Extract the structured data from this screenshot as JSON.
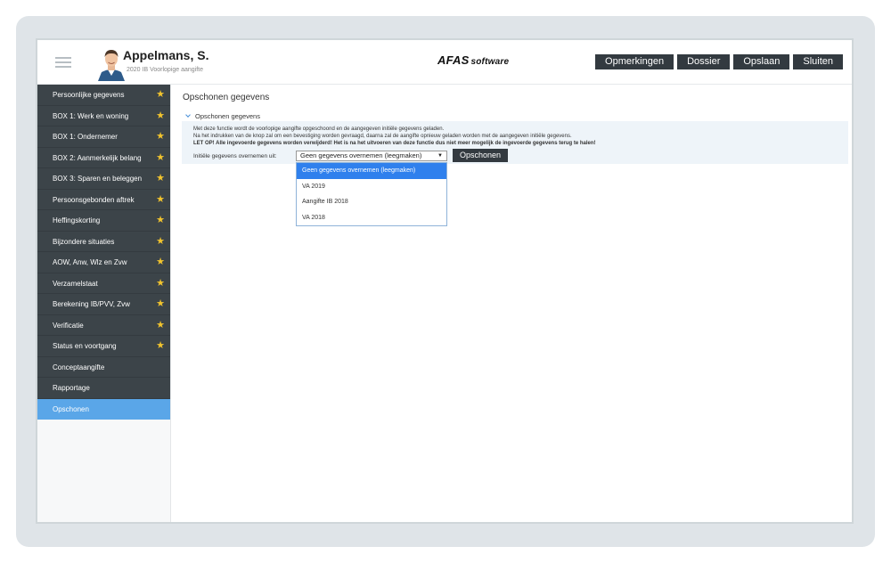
{
  "header": {
    "user_name": "Appelmans, S.",
    "subtitle": "2020 IB Voorlopige aangifte",
    "brand_main": "AFAS",
    "brand_suffix": "software",
    "buttons": [
      "Opmerkingen",
      "Dossier",
      "Opslaan",
      "Sluiten"
    ]
  },
  "sidebar": {
    "items": [
      {
        "label": "Persoonlijke gegevens",
        "star": "★"
      },
      {
        "label": "BOX 1: Werk en woning",
        "star": "★"
      },
      {
        "label": "BOX 1: Ondernemer",
        "star": "★"
      },
      {
        "label": "BOX 2: Aanmerkelijk belang",
        "star": "★"
      },
      {
        "label": "BOX 3: Sparen en beleggen",
        "star": "★"
      },
      {
        "label": "Persoonsgebonden aftrek",
        "star": "★"
      },
      {
        "label": "Heffingskorting",
        "star": "★"
      },
      {
        "label": "Bijzondere situaties",
        "star": "★"
      },
      {
        "label": "AOW, Anw, Wlz en Zvw",
        "star": "★"
      },
      {
        "label": "Verzamelstaat",
        "star": "★"
      },
      {
        "label": "Berekening IB/PVV, Zvw",
        "star": "★"
      },
      {
        "label": "Verificatie",
        "star": "★"
      },
      {
        "label": "Status en voortgang",
        "star": "★"
      },
      {
        "label": "Conceptaangifte",
        "star": ""
      },
      {
        "label": "Rapportage",
        "star": ""
      },
      {
        "label": "Opschonen",
        "star": ""
      }
    ],
    "active_index": 15
  },
  "main": {
    "title": "Opschonen gegevens",
    "section_title": "Opschonen gegevens",
    "info_lines": [
      "Met deze functie wordt de voorlopige aangifte opgeschoond en de aangegeven initiële gegevens geladen.",
      "Na het indrukken van de knop zal om een bevestiging worden gevraagd, daarna zal de aangifte opnieuw geladen worden met de aangegeven initiële gegevens.",
      "LET OP! Alle ingevoerde gegevens worden verwijderd! Het is na het uitvoeren van deze functie dus niet meer mogelijk de ingevoerde gegevens terug te halen!"
    ],
    "field_label": "Initiële gegevens overnemen uit:",
    "select_value": "Geen gegevens overnemen (leegmaken)",
    "select_arrow": "▼",
    "button_label": "Opschonen",
    "dropdown_options": [
      "Geen gegevens overnemen (leegmaken)",
      "VA 2019",
      "Aangifte IB 2018",
      "VA 2018"
    ]
  },
  "colors": {
    "sidebar_bg": "#3c4449",
    "active_item": "#5aa6e8",
    "star": "#f2c42e",
    "button_bg": "#333a40",
    "dropdown_selected": "#2f80ed"
  }
}
